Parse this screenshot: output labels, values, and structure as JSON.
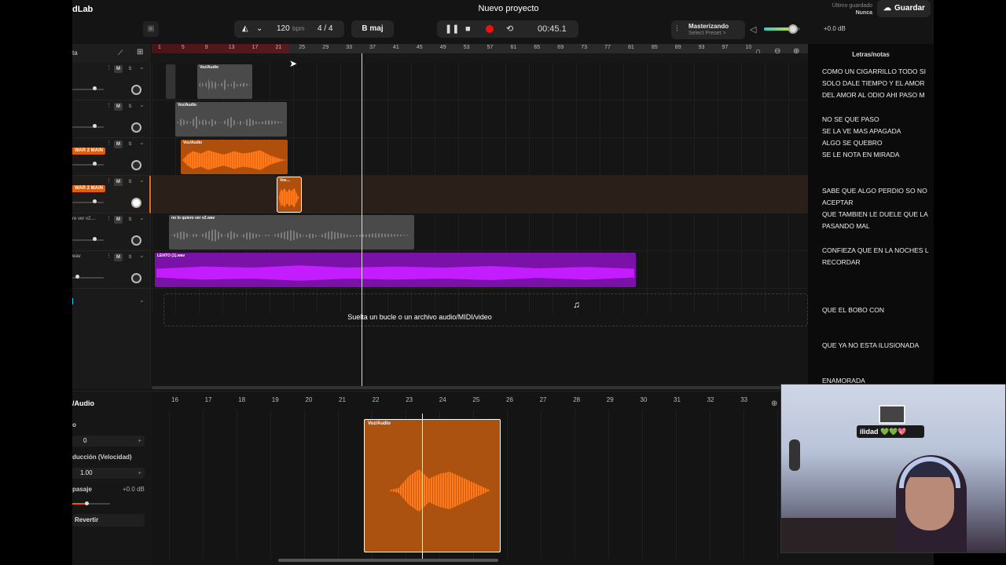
{
  "app": {
    "logo_fragment": "dLab",
    "project_title": "Nuevo proyecto",
    "save_label": "Guardar",
    "last_saved_label": "Último guardado",
    "last_saved_value": "Nunca"
  },
  "toolbar": {
    "tempo": "120",
    "tempo_unit": "bpm",
    "time_signature": "4 / 4",
    "key": "B maj",
    "time": "00:45.1",
    "mastering_title": "Masterizando",
    "mastering_preset": "Select Preset >",
    "master_volume_db": "+0.0 dB",
    "master_volume_level": 0.8
  },
  "tracks_header": {
    "label": "ta"
  },
  "tracks": [
    {
      "name": "",
      "tag": "",
      "mute": "M",
      "solo": "S"
    },
    {
      "name": "",
      "tag": "",
      "mute": "M",
      "solo": "S"
    },
    {
      "name": "",
      "tag": "WAR 2 MAIN",
      "mute": "M",
      "solo": "S"
    },
    {
      "name": "",
      "tag": "WAR 2 MAIN",
      "mute": "M",
      "solo": "S"
    },
    {
      "name": "re ver v2....",
      "tag": "",
      "mute": "M",
      "solo": "S"
    },
    {
      "name": "wav",
      "tag": "",
      "mute": "M",
      "solo": "S"
    }
  ],
  "ruler_marks": [
    "1",
    "5",
    "9",
    "13",
    "17",
    "21",
    "25",
    "29",
    "33",
    "37",
    "41",
    "45",
    "49",
    "53",
    "57",
    "61",
    "65",
    "69",
    "73",
    "77",
    "81",
    "85",
    "89",
    "93",
    "97",
    "10"
  ],
  "clips": [
    {
      "name": "Voz/Audio"
    },
    {
      "name": "Voz/Audio"
    },
    {
      "name": "Voz/Audio"
    },
    {
      "name": "Voz..."
    },
    {
      "name": "no lo quiero ver v2.wav"
    },
    {
      "name": "LENTO (1).wav"
    }
  ],
  "drop_zone": {
    "text": "Suelta un bucle o un archivo audio/MIDI/video"
  },
  "lyrics": {
    "title": "Letras/notas",
    "lines": [
      "COMO UN CIGARRILLO TODO SI",
      "SOLO DALE  TIEMPO Y EL AMOR",
      " DEL AMOR AL ODIO AHI PASO M",
      "NO SE QUE PASO",
      "SE LA VE MAS APAGADA",
      "ALGO SE QUEBRO",
      "SE LE NOTA EN MIRADA",
      "SABE QUE ALGO PERDIO SO NO",
      "ACEPTAR",
      "QUE TAMBIEN LE DUELE QUE LA",
      "PASANDO MAL",
      "CONFIEZA QUE EN LA NOCHES L",
      "RECORDAR",
      "QUE EL BOBO CON",
      "QUE YA NO ESTA ILUSIONADA",
      "ENAMORADA"
    ]
  },
  "editor": {
    "title": "/Audio",
    "field1_label": "o",
    "field1_value": "0",
    "field2_label": "ducción (Velocidad)",
    "field2_value": "1.00",
    "field3_label": "pasaje",
    "field3_value": "+0.0 dB",
    "revert_label": "Revertir",
    "ruler_marks": [
      "16",
      "17",
      "18",
      "19",
      "20",
      "21",
      "22",
      "23",
      "24",
      "25",
      "26",
      "27",
      "28",
      "29",
      "30",
      "31",
      "32",
      "33"
    ],
    "clip_name": "Voz/Audio"
  },
  "webcam": {
    "sign_text": "ilidad 💚💚💖"
  }
}
